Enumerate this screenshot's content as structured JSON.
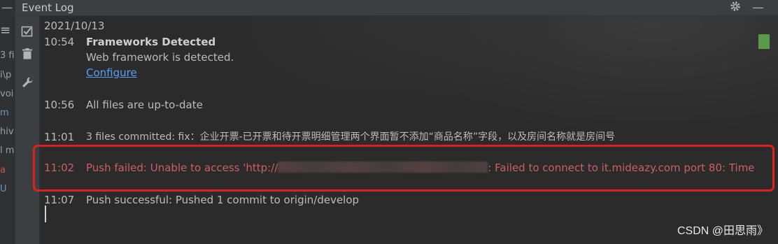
{
  "titlebar": {
    "title": "Event Log",
    "icons": [
      "gear-icon",
      "minimize-icon",
      "collapse-icon"
    ]
  },
  "toolbar": {
    "icons": [
      "mark-all-read-icon",
      "trash-icon",
      "wrench-icon"
    ]
  },
  "left_fragments": [
    "3 fi",
    "i\\p",
    "voi",
    "m",
    "hiv",
    "l m",
    "a",
    "U"
  ],
  "log": {
    "date": "2021/10/13",
    "entries": [
      {
        "time": "10:54",
        "title": "Frameworks Detected",
        "text": "Web framework is detected.",
        "link": "Configure"
      },
      {
        "time": "10:56",
        "text": "All files are up-to-date"
      },
      {
        "time": "11:01",
        "text": "3 files committed: fix：企业开票-已开票和待开票明细管理两个界面暂不添加“商品名称”字段，以及房间名称就是房间号"
      },
      {
        "time": "11:02",
        "text_before": "Push failed: Unable to access 'http://",
        "text_after": ": Failed to connect to it.mideazy.com port 80: Time",
        "status": "error"
      },
      {
        "time": "11:07",
        "text": "Push successful: Pushed 1 commit to origin/develop"
      }
    ]
  },
  "colors": {
    "background": "#2b2b2b",
    "error": "#cc5f5f",
    "link": "#589df6",
    "highlight_box": "#e0201f",
    "status_green": "#5b9a4a"
  },
  "watermark": "CSDN @田思雨》"
}
